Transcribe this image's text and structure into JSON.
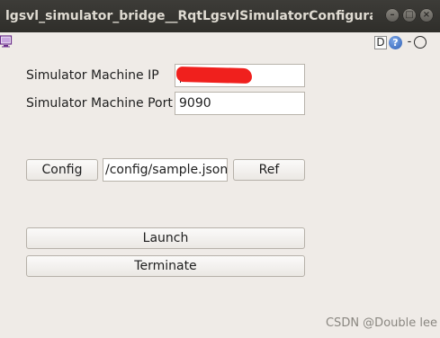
{
  "window": {
    "title": "lgsvl_simulator_bridge__RqtLgsvlSimulatorConfigurator...",
    "controls": {
      "minimize": "–",
      "maximize": "□",
      "close": "×"
    }
  },
  "toolbar": {
    "d_label": "D",
    "help_label": "?",
    "dash_label": "-",
    "plugin_icon": "monitor-icon"
  },
  "form": {
    "ip_label": "Simulator Machine IP",
    "ip_value": "",
    "port_label": "Simulator Machine Port",
    "port_value": "9090"
  },
  "config": {
    "button_label": "Config",
    "path_value": "/config/sample.json",
    "ref_label": "Ref"
  },
  "actions": {
    "launch_label": "Launch",
    "terminate_label": "Terminate"
  },
  "watermark": "CSDN @Double lee",
  "colors": {
    "titlebar": "#2f2e2a",
    "window_bg": "#efebe7",
    "redaction": "#f0201d",
    "help": "#2e5fb5"
  }
}
